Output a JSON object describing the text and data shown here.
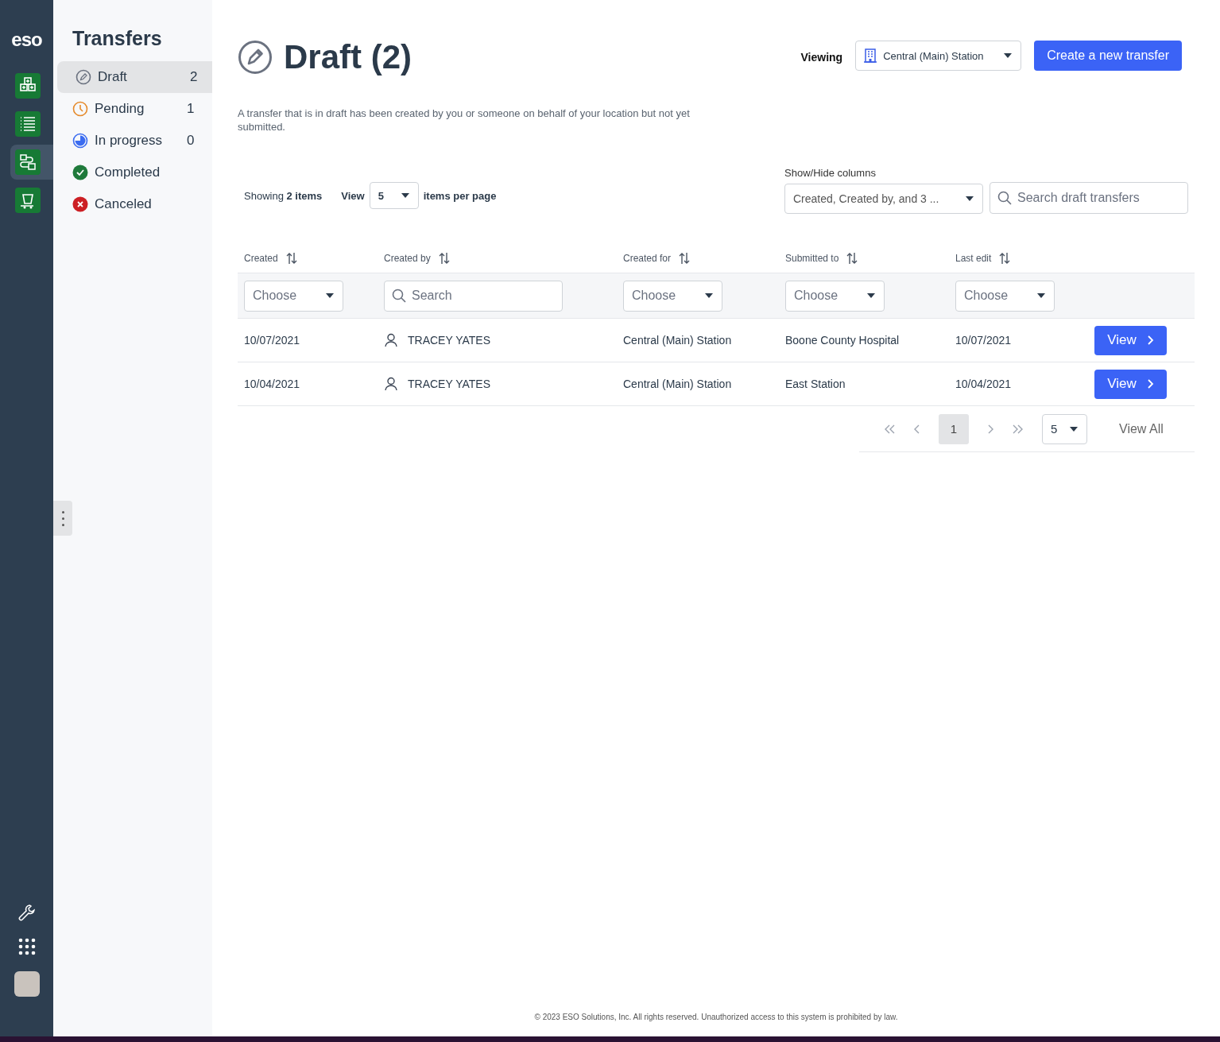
{
  "rail": {
    "logo": "eso",
    "nav": [
      {
        "kind": "grid",
        "selected": false
      },
      {
        "kind": "list",
        "selected": false
      },
      {
        "kind": "transfer",
        "selected": true
      },
      {
        "kind": "cart",
        "selected": false
      }
    ],
    "bottom": [
      {
        "kind": "wrench"
      },
      {
        "kind": "apps"
      },
      {
        "kind": "avatar"
      }
    ]
  },
  "sidebar": {
    "title": "Transfers",
    "items": [
      {
        "kind": "draft",
        "label": "Draft",
        "count": "2",
        "selected": true
      },
      {
        "kind": "pending",
        "label": "Pending",
        "count": "1",
        "selected": false
      },
      {
        "kind": "in_progress",
        "label": "In progress",
        "count": "0",
        "selected": false
      },
      {
        "kind": "completed",
        "label": "Completed",
        "selected": false
      },
      {
        "kind": "canceled",
        "label": "Canceled",
        "selected": false
      }
    ]
  },
  "header": {
    "title": "Draft (2)",
    "viewing_label": "Viewing",
    "station": "Central (Main) Station",
    "create_button": "Create a new transfer",
    "description": "A transfer that is in draft has been created by you or someone on behalf of your location but not yet submitted."
  },
  "toolbar": {
    "showing": "Showing **2 items**",
    "view_label": "View",
    "per_page": "5",
    "per_page_label": "items per page",
    "columns_label": "Show/Hide columns",
    "columns_value": "Created, Created by, and 3 ...",
    "search_placeholder": "Search draft transfers"
  },
  "table": {
    "columns": [
      {
        "label": "Created"
      },
      {
        "label": "Created by"
      },
      {
        "label": "Created for"
      },
      {
        "label": "Submitted to"
      },
      {
        "label": "Last edit"
      }
    ],
    "filters": [
      {
        "kind": "choose",
        "placeholder": "Choose"
      },
      {
        "kind": "search",
        "placeholder": "Search"
      },
      {
        "kind": "choose",
        "placeholder": "Choose"
      },
      {
        "kind": "choose",
        "placeholder": "Choose"
      },
      {
        "kind": "choose",
        "placeholder": "Choose"
      }
    ],
    "rows": [
      {
        "cells": [
          "10/07/2021",
          "TRACEY YATES",
          "Central (Main) Station",
          "Boone County Hospital",
          "10/07/2021"
        ],
        "action": "View"
      },
      {
        "cells": [
          "10/04/2021",
          "TRACEY YATES",
          "Central (Main) Station",
          "East Station",
          "10/04/2021"
        ],
        "action": "View"
      }
    ]
  },
  "pagination": {
    "pages": [
      {
        "label": "1",
        "selected": true
      }
    ],
    "page_size": "5",
    "view_all": "View All"
  },
  "footer": "© 2023 ESO Solutions, Inc. All rights reserved. Unauthorized access to this system is prohibited by law."
}
